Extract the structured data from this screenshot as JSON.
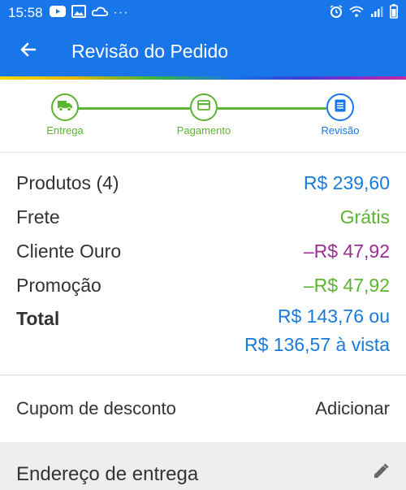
{
  "status_bar": {
    "time": "15:58",
    "icons": [
      "youtube-icon",
      "gallery-icon",
      "cloud-icon",
      "more-dots-icon",
      "alarm-icon",
      "wifi-icon",
      "signal-icon",
      "battery-icon"
    ],
    "more": "···"
  },
  "header": {
    "title": "Revisão do Pedido",
    "back_icon": "arrow-left-icon"
  },
  "steps": [
    {
      "label": "Entrega",
      "icon": "truck-icon",
      "state": "done"
    },
    {
      "label": "Pagamento",
      "icon": "card-icon",
      "state": "done"
    },
    {
      "label": "Revisão",
      "icon": "list-icon",
      "state": "current"
    }
  ],
  "summary": {
    "products_label": "Produtos (4)",
    "products_value": "R$ 239,60",
    "shipping_label": "Frete",
    "shipping_value": "Grátis",
    "gold_label": "Cliente Ouro",
    "gold_value": "–R$ 47,92",
    "promo_label": "Promoção",
    "promo_value": "–R$ 47,92",
    "total_label": "Total",
    "total_value_1": "R$ 143,76 ou",
    "total_value_2": "R$ 136,57 à vista"
  },
  "coupon": {
    "label": "Cupom de desconto",
    "action": "Adicionar"
  },
  "address": {
    "label": "Endereço de entrega",
    "edit_icon": "pencil-icon"
  },
  "colors": {
    "primary": "#1976e8",
    "green": "#5bb531",
    "purple": "#9b2e8f",
    "price_blue": "#1a7ad9"
  }
}
